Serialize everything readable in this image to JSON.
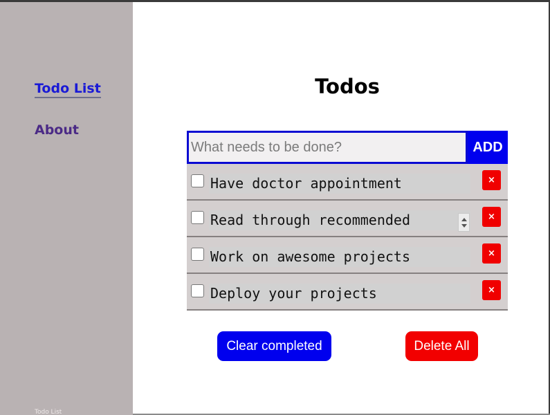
{
  "sidebar": {
    "nav": [
      {
        "label": "Todo List"
      },
      {
        "label": "About"
      }
    ],
    "footer_text": "Todo List"
  },
  "main": {
    "title": "Todos",
    "input": {
      "placeholder": "What needs to be done?",
      "value": ""
    },
    "add_label": "ADD",
    "todos": [
      {
        "text": "Have doctor appointment",
        "completed": false,
        "delete_label": "×"
      },
      {
        "text": "Read through recommended",
        "completed": false,
        "delete_label": "×"
      },
      {
        "text": "Work on awesome projects",
        "completed": false,
        "delete_label": "×"
      },
      {
        "text": "Deploy your projects",
        "completed": false,
        "delete_label": "×"
      }
    ],
    "clear_completed_label": "Clear completed",
    "delete_all_label": "Delete All"
  },
  "colors": {
    "sidebar_bg": "#b9b2b3",
    "active_link": "#1a1ad6",
    "link": "#4b2a86",
    "primary_blue": "#0000ee",
    "danger_red": "#f00000",
    "item_bg": "#d4cfcf"
  }
}
